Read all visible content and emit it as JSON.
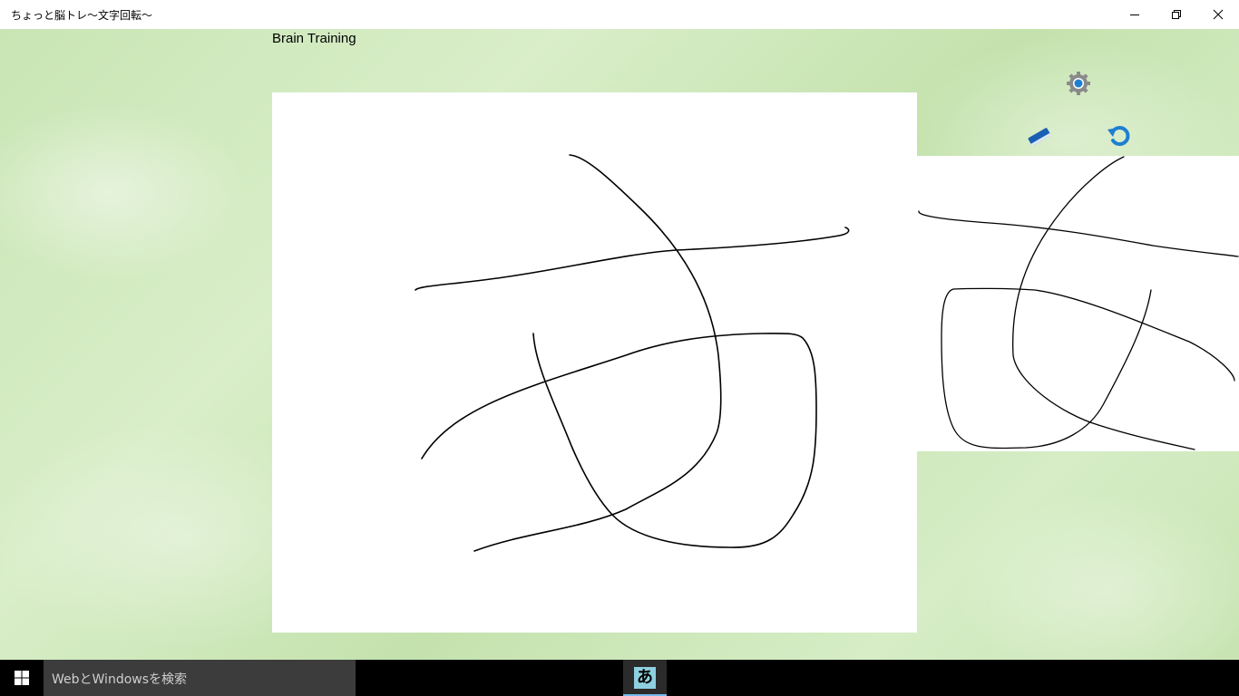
{
  "window": {
    "title": "ちょっと脳トレ〜文字回転〜",
    "controls": [
      "minimize-icon",
      "restore-icon",
      "close-icon"
    ]
  },
  "app": {
    "heading": "Brain Training",
    "background_color": "#cfe8bd",
    "canvas_color": "#ffffff",
    "stroke_color": "#000000"
  },
  "toolbar": {
    "settings_icon": "gear-icon",
    "eraser_icon": "eraser-icon",
    "rotate_icon": "rotate-icon",
    "accent_color": "#1e7fd0"
  },
  "taskbar": {
    "search_placeholder": "WebとWindowsを検索",
    "running_app_glyph": "あ",
    "running_app_color": "#8fd0e0"
  }
}
